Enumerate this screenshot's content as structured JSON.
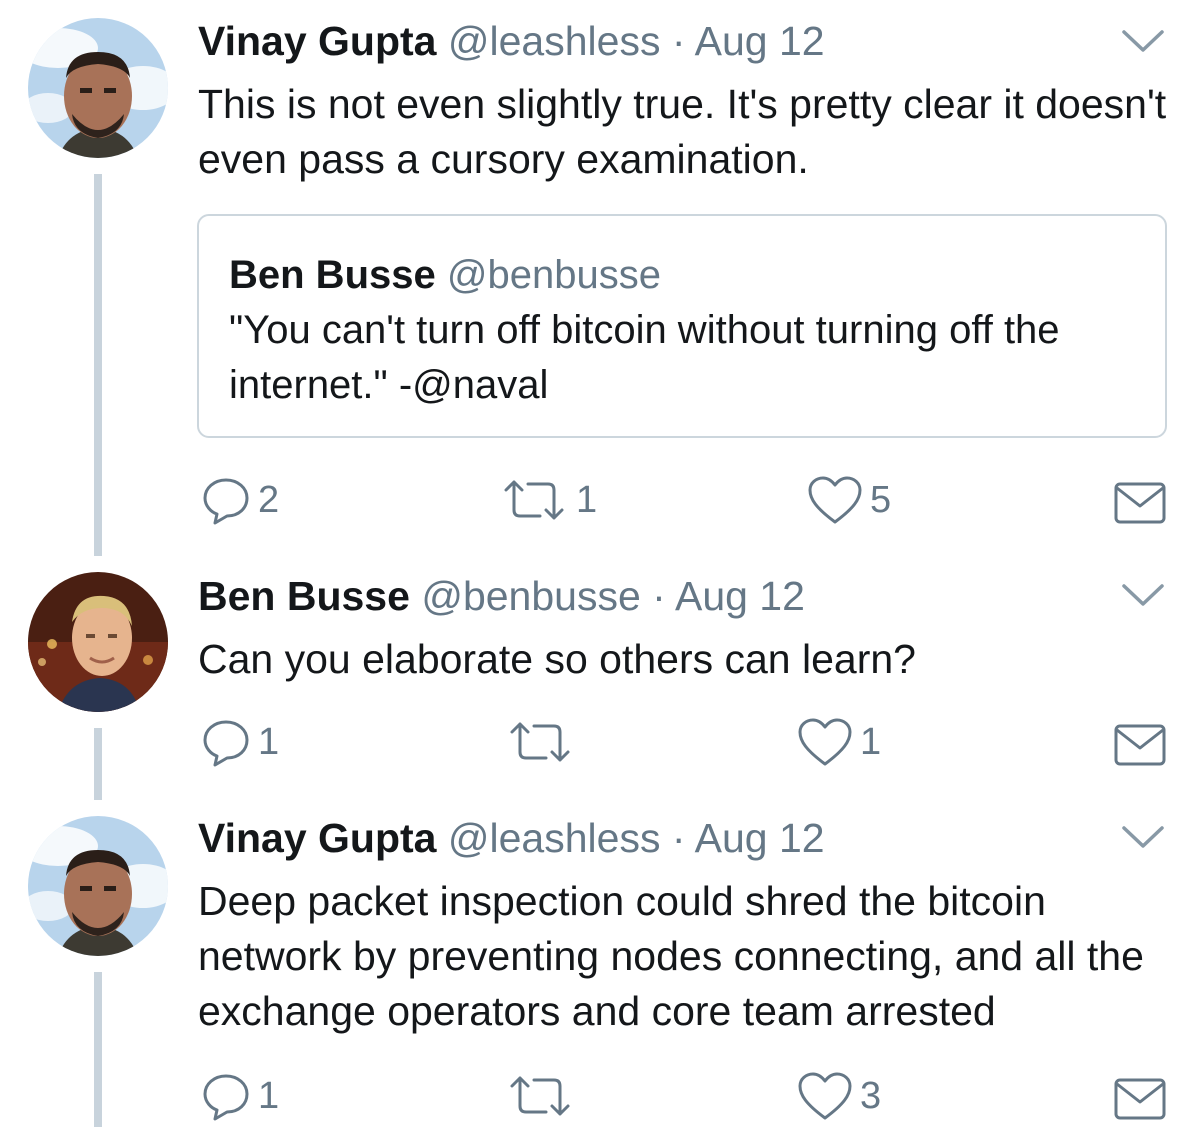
{
  "tweets": [
    {
      "name": "Vinay Gupta",
      "handle": "@leashless",
      "separator": "·",
      "date": "Aug 12",
      "text": "This is not even slightly true. It's pretty clear it doesn't even pass a cursory examination.",
      "quoted": {
        "name": "Ben Busse",
        "handle": "@benbusse",
        "text": "\"You can't turn off bitcoin without turning off the internet.\" -@naval"
      },
      "actions": {
        "reply_count": "2",
        "retweet_count": "1",
        "like_count": "5"
      },
      "icons": {
        "reply": "reply-icon",
        "retweet": "retweet-icon",
        "like": "heart-icon",
        "dm": "envelope-icon",
        "more": "chevron-down-icon"
      }
    },
    {
      "name": "Ben Busse",
      "handle": "@benbusse",
      "separator": "·",
      "date": "Aug 12",
      "text": "Can you elaborate so others can learn?",
      "actions": {
        "reply_count": "1",
        "retweet_count": "",
        "like_count": "1"
      }
    },
    {
      "name": "Vinay Gupta",
      "handle": "@leashless",
      "separator": "·",
      "date": "Aug 12",
      "text": "Deep packet inspection could shred the bitcoin network by preventing nodes connecting, and all the exchange operators and core team arrested",
      "actions": {
        "reply_count": "1",
        "retweet_count": "",
        "like_count": "3"
      }
    }
  ],
  "colors": {
    "text": "#14171a",
    "secondary": "#657786",
    "thread_line": "#c8d3dc",
    "border": "#ccd6dd"
  }
}
